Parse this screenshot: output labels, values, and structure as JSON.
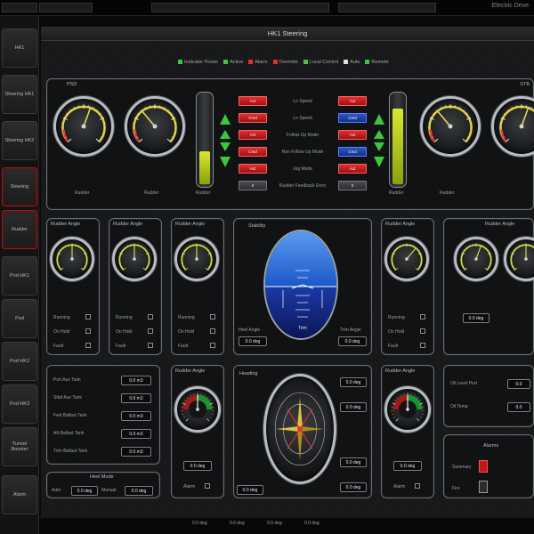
{
  "window": {
    "title": "HK1 Steering",
    "status_right": "Electric Drive"
  },
  "nav": {
    "items": [
      {
        "label": "HK1",
        "active": false
      },
      {
        "label": "Steering HK1",
        "active": false
      },
      {
        "label": "Steering HK2",
        "active": false
      },
      {
        "label": "Steering",
        "active": true
      },
      {
        "label": "Rudder",
        "active": true
      },
      {
        "label": "Pod HK1",
        "active": false
      },
      {
        "label": "Pod",
        "active": false
      },
      {
        "label": "Pod HK2",
        "active": false
      },
      {
        "label": "Pod HK3",
        "active": false
      },
      {
        "label": "Tunnel Booster",
        "active": false
      },
      {
        "label": "Alarm",
        "active": false
      }
    ]
  },
  "legend": [
    {
      "label": "Indicator Power",
      "color": "#3cc83c"
    },
    {
      "label": "Active",
      "color": "#3cc83c"
    },
    {
      "label": "Alarm",
      "color": "#e03030"
    },
    {
      "label": "Override",
      "color": "#e03030"
    },
    {
      "label": "Local Control",
      "color": "#3cc83c"
    },
    {
      "label": "Auto",
      "color": "#e0e0e0"
    },
    {
      "label": "Remote",
      "color": "#3cc83c"
    }
  ],
  "top_panel": {
    "title_left": "PSD",
    "title_right": "STB",
    "gauge_labels": [
      "Rudder",
      "Rudder",
      "Rudder",
      "Rudder"
    ],
    "tube_label_left": "Rudder",
    "tube_label_right": "Rudder",
    "mid_rows": [
      {
        "label": "Lo Speed",
        "left": "Act",
        "right": "Act"
      },
      {
        "label": "Lo Speed",
        "left": "Cmd",
        "right": "Cmd"
      },
      {
        "label": "Follow Up Mode",
        "left": "Act",
        "right": "Act"
      },
      {
        "label": "Non Follow Up Mode",
        "left": "Cmd",
        "right": "Cmd"
      },
      {
        "label": "Jog Mode",
        "left": "Act",
        "right": "Act"
      },
      {
        "label": "Rudder Feedback Error",
        "left": "0",
        "right": "0"
      }
    ]
  },
  "gauge_panels": {
    "p1": {
      "title": "Rudder Angle",
      "rows": [
        "Running",
        "On Hold",
        "Fault"
      ]
    },
    "p2": {
      "title": "Rudder Angle",
      "rows": [
        "Running",
        "On Hold",
        "Fault"
      ]
    },
    "p3": {
      "title": "Rudder Angle",
      "rows": [
        "Running",
        "On Hold",
        "Fault"
      ]
    },
    "p4": {
      "title": "Rudder Angle",
      "rows": [
        "Running",
        "On Hold",
        "Fault"
      ]
    },
    "p5": {
      "title": "Rudder Angle",
      "readout": "0.0 deg"
    }
  },
  "attitude": {
    "title": "Stability",
    "left_label": "Heel Angle",
    "left_value": "0.0 deg",
    "right_label": "Trim Angle",
    "right_value": "0.0 deg",
    "center_tag": "Trim"
  },
  "table_panel": {
    "rows": [
      {
        "label": "Port Aux Tank",
        "value": "0.0 m3"
      },
      {
        "label": "Stbd Aux Tank",
        "value": "0.0 m3"
      },
      {
        "label": "Fwd Ballast Tank",
        "value": "0.0 m3"
      },
      {
        "label": "Aft Ballast Tank",
        "value": "0.0 m3"
      },
      {
        "label": "Trim Ballast Tank",
        "value": "0.0 m3"
      }
    ]
  },
  "rudder_left": {
    "title": "Rudder Angle",
    "readout": "0.0 deg",
    "footer": "Alarm"
  },
  "rudder_right": {
    "title": "Rudder Angle",
    "readout": "0.0 deg",
    "footer": "Alarm"
  },
  "compass": {
    "title": "Heading",
    "readouts": [
      "0.0 deg",
      "0.0 deg",
      "0.0 deg",
      "0.0 deg"
    ],
    "bottom_left": "0.0 deg"
  },
  "right_lower": {
    "rows": [
      {
        "label": "Oil Level Port",
        "value": "0.0"
      },
      {
        "label": "Oil Temp",
        "value": "0.0"
      }
    ]
  },
  "alarm_panel": {
    "title": "Alarms",
    "items": [
      "Summary",
      "Fire"
    ]
  },
  "bottom_panel": {
    "title": "Heel Mode",
    "left_label": "Auto",
    "left_value": "0.0 deg",
    "right_label": "Manual",
    "right_value": "0.0 deg"
  },
  "bottom_bar": {
    "items": [
      "0.0 deg",
      "0.0 deg",
      "0.0 deg",
      "0.0 deg"
    ]
  }
}
